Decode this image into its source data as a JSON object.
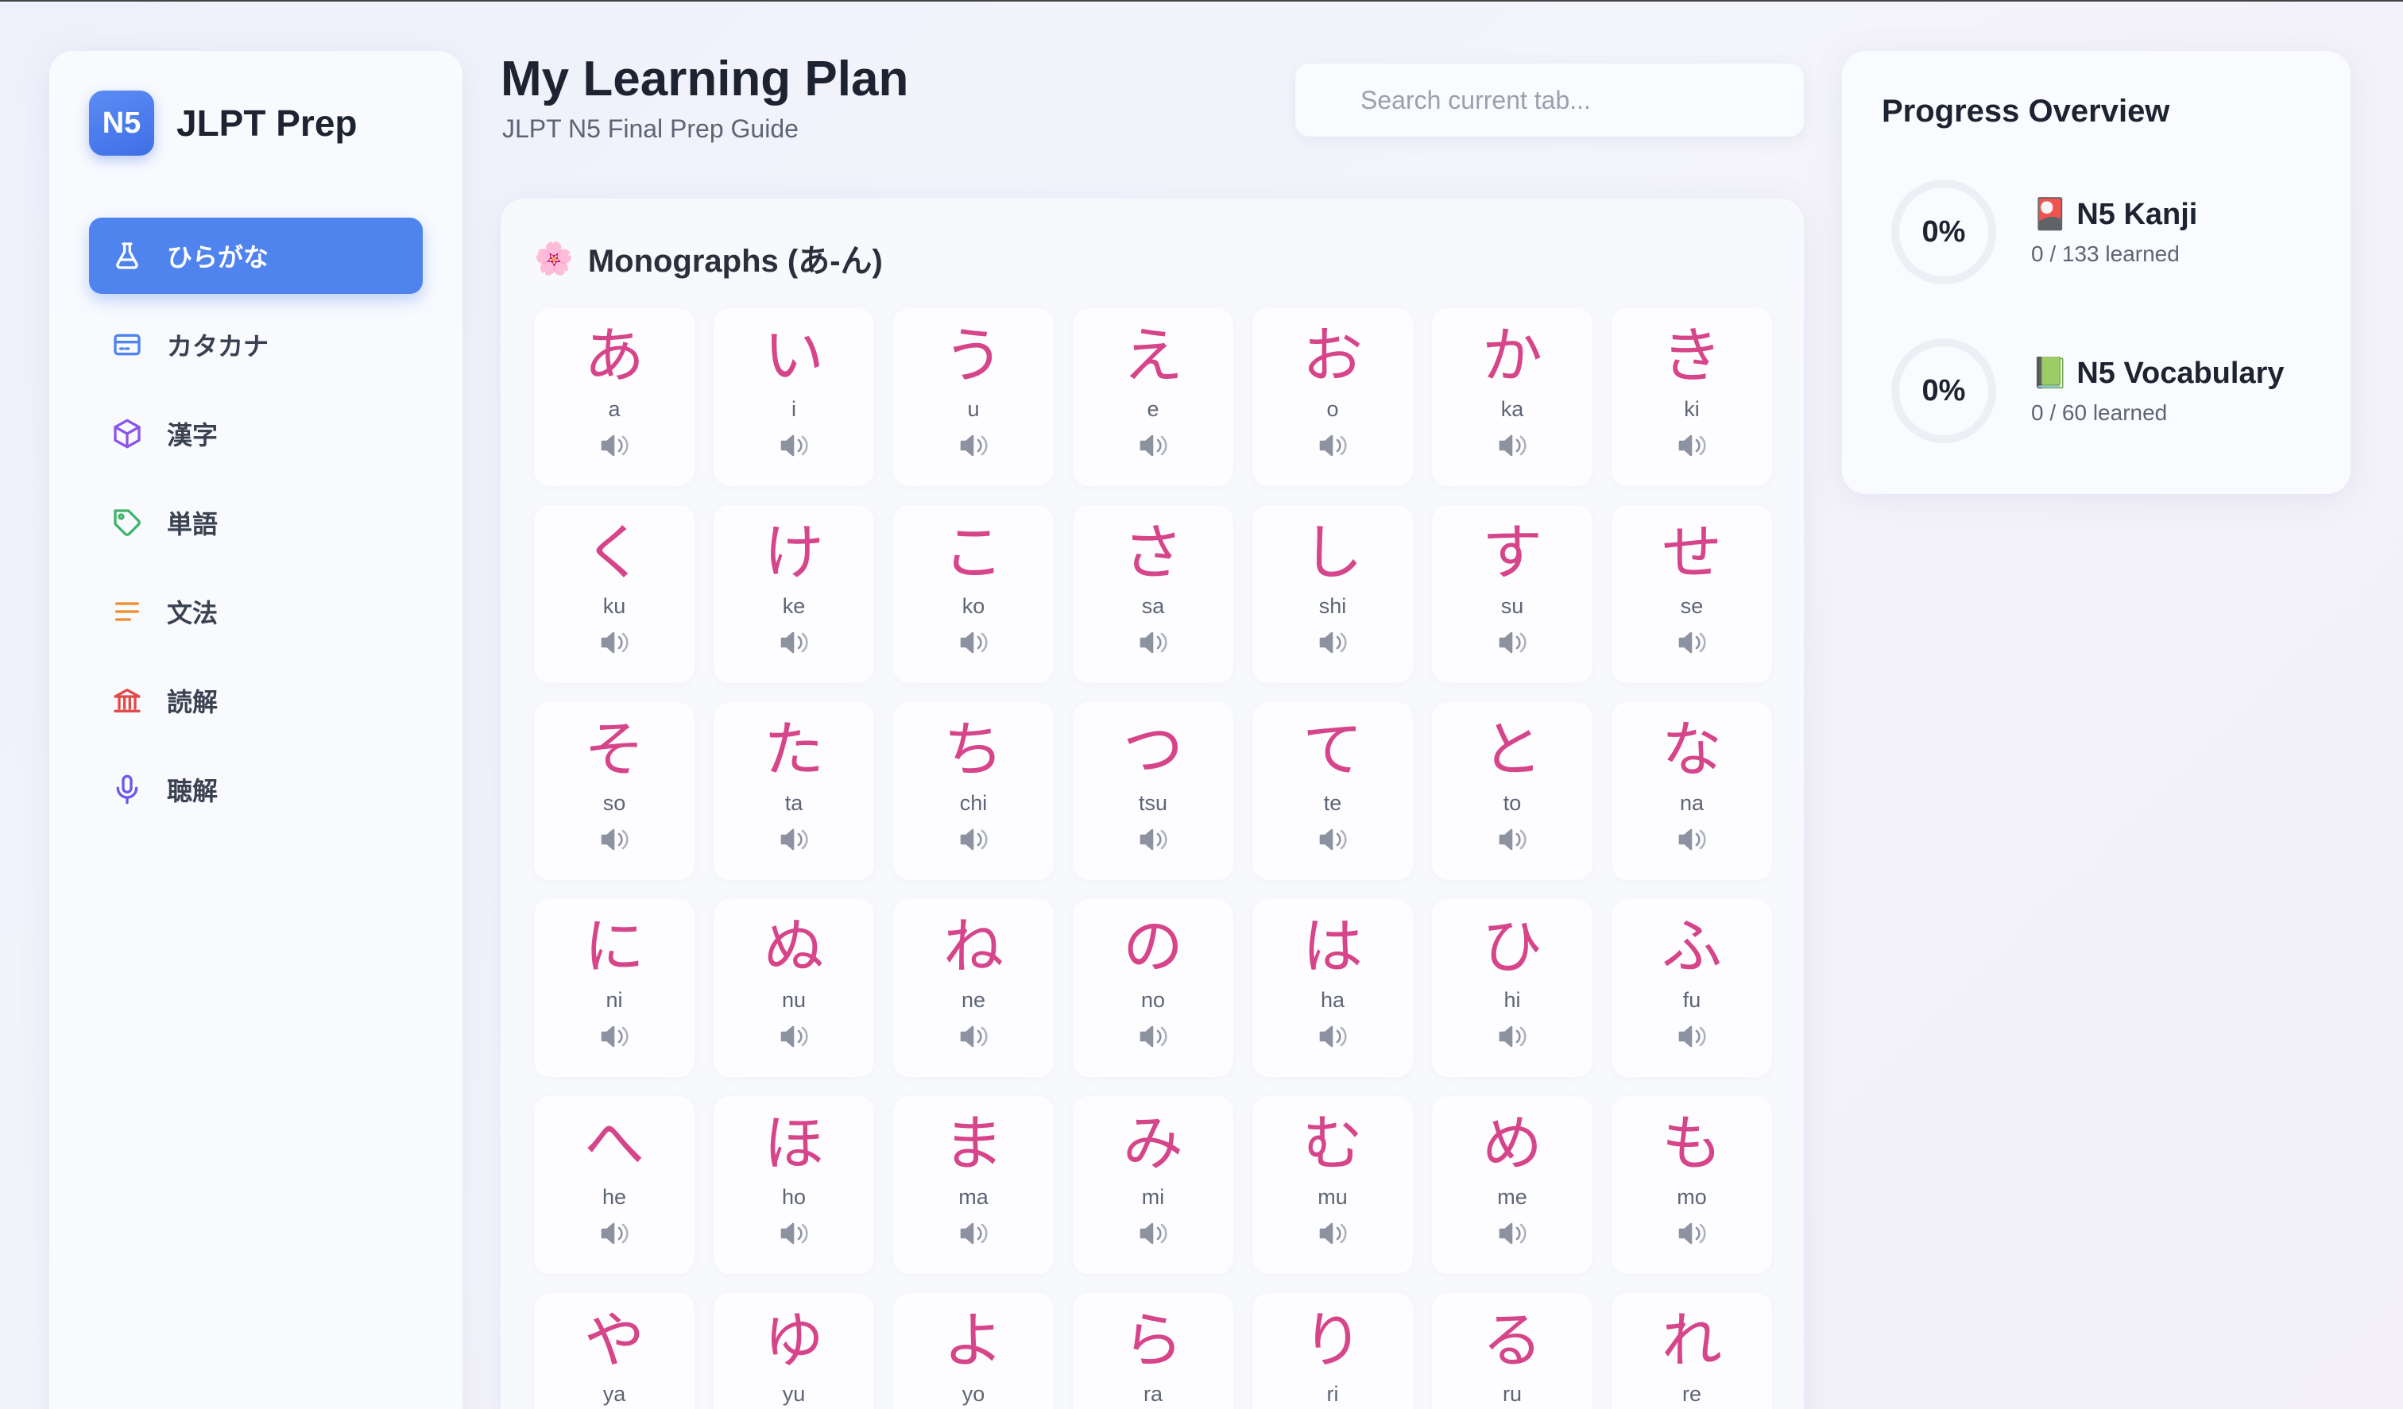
{
  "brand": {
    "badge": "N5",
    "name": "JLPT Prep"
  },
  "nav": [
    {
      "label": "ひらがな",
      "icon": "flask-icon",
      "active": true
    },
    {
      "label": "カタカナ",
      "icon": "card-icon",
      "active": false
    },
    {
      "label": "漢字",
      "icon": "cube-icon",
      "active": false
    },
    {
      "label": "単語",
      "icon": "tag-icon",
      "active": false
    },
    {
      "label": "文法",
      "icon": "lines-icon",
      "active": false
    },
    {
      "label": "読解",
      "icon": "bank-icon",
      "active": false
    },
    {
      "label": "聴解",
      "icon": "microphone-icon",
      "active": false
    }
  ],
  "header": {
    "title": "My Learning Plan",
    "subtitle": "JLPT N5 Final Prep Guide",
    "search_placeholder": "Search current tab..."
  },
  "section": {
    "emoji": "🌸",
    "title": "Monographs (あ-ん)"
  },
  "kana": [
    {
      "char": "あ",
      "romaji": "a"
    },
    {
      "char": "い",
      "romaji": "i"
    },
    {
      "char": "う",
      "romaji": "u"
    },
    {
      "char": "え",
      "romaji": "e"
    },
    {
      "char": "お",
      "romaji": "o"
    },
    {
      "char": "か",
      "romaji": "ka"
    },
    {
      "char": "き",
      "romaji": "ki"
    },
    {
      "char": "く",
      "romaji": "ku"
    },
    {
      "char": "け",
      "romaji": "ke"
    },
    {
      "char": "こ",
      "romaji": "ko"
    },
    {
      "char": "さ",
      "romaji": "sa"
    },
    {
      "char": "し",
      "romaji": "shi"
    },
    {
      "char": "す",
      "romaji": "su"
    },
    {
      "char": "せ",
      "romaji": "se"
    },
    {
      "char": "そ",
      "romaji": "so"
    },
    {
      "char": "た",
      "romaji": "ta"
    },
    {
      "char": "ち",
      "romaji": "chi"
    },
    {
      "char": "つ",
      "romaji": "tsu"
    },
    {
      "char": "て",
      "romaji": "te"
    },
    {
      "char": "と",
      "romaji": "to"
    },
    {
      "char": "な",
      "romaji": "na"
    },
    {
      "char": "に",
      "romaji": "ni"
    },
    {
      "char": "ぬ",
      "romaji": "nu"
    },
    {
      "char": "ね",
      "romaji": "ne"
    },
    {
      "char": "の",
      "romaji": "no"
    },
    {
      "char": "は",
      "romaji": "ha"
    },
    {
      "char": "ひ",
      "romaji": "hi"
    },
    {
      "char": "ふ",
      "romaji": "fu"
    },
    {
      "char": "へ",
      "romaji": "he"
    },
    {
      "char": "ほ",
      "romaji": "ho"
    },
    {
      "char": "ま",
      "romaji": "ma"
    },
    {
      "char": "み",
      "romaji": "mi"
    },
    {
      "char": "む",
      "romaji": "mu"
    },
    {
      "char": "め",
      "romaji": "me"
    },
    {
      "char": "も",
      "romaji": "mo"
    },
    {
      "char": "や",
      "romaji": "ya"
    },
    {
      "char": "ゆ",
      "romaji": "yu"
    },
    {
      "char": "よ",
      "romaji": "yo"
    },
    {
      "char": "ら",
      "romaji": "ra"
    },
    {
      "char": "り",
      "romaji": "ri"
    },
    {
      "char": "る",
      "romaji": "ru"
    },
    {
      "char": "れ",
      "romaji": "re"
    }
  ],
  "progress": {
    "title": "Progress Overview",
    "items": [
      {
        "percent": "0%",
        "emoji": "🎴",
        "name": "N5 Kanji",
        "sub": "0 / 133 learned"
      },
      {
        "percent": "0%",
        "emoji": "📗",
        "name": "N5 Vocabulary",
        "sub": "0 / 60 learned"
      }
    ]
  },
  "colors": {
    "accent": "#4f83ee",
    "kana": "#d6458a"
  }
}
